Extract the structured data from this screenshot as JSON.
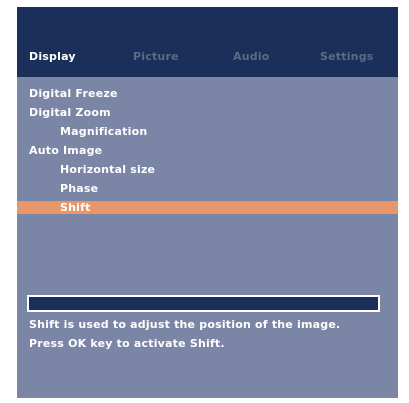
{
  "tabs": [
    {
      "label": "Display",
      "active": true
    },
    {
      "label": "Picture",
      "active": false
    },
    {
      "label": "Audio",
      "active": false
    },
    {
      "label": "Settings",
      "active": false
    }
  ],
  "menu": {
    "items": [
      {
        "label": "Digital Freeze",
        "level": 0,
        "selected": false
      },
      {
        "label": "Digital Zoom",
        "level": 0,
        "selected": false
      },
      {
        "label": "Magnification",
        "level": 1,
        "selected": false
      },
      {
        "label": "Auto Image",
        "level": 0,
        "selected": false
      },
      {
        "label": "Horizontal size",
        "level": 1,
        "selected": false
      },
      {
        "label": "Phase",
        "level": 1,
        "selected": false
      },
      {
        "label": "Shift",
        "level": 1,
        "selected": true
      }
    ]
  },
  "progress": {
    "value": 0
  },
  "help": {
    "line1": "Shift is used to adjust the position of the image.",
    "line2": "Press OK key to activate Shift."
  },
  "colors": {
    "header_bg": "#1a2f59",
    "panel_bg": "#7b85a5",
    "highlight": "#e8976a",
    "inactive_tab": "#5d6a88",
    "text": "#ffffff"
  }
}
